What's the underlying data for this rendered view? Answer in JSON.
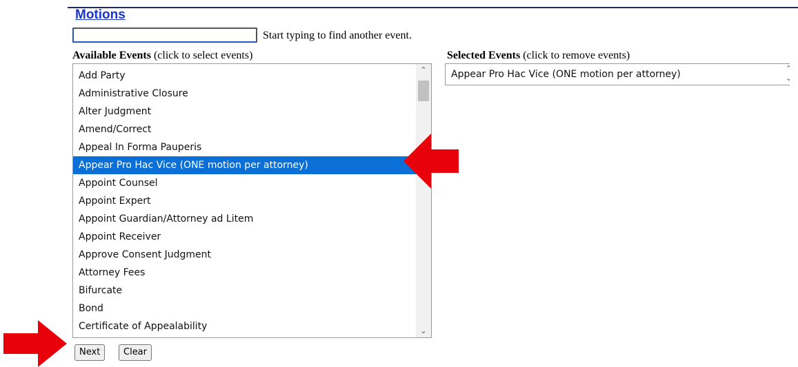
{
  "section": {
    "title": "Motions"
  },
  "search": {
    "value": "",
    "hint": "Start typing to find another event."
  },
  "available": {
    "label_bold": "Available Events",
    "label_rest": " (click to select events)",
    "items": [
      "Add Party",
      "Administrative Closure",
      "Alter Judgment",
      "Amend/Correct",
      "Appeal In Forma Pauperis",
      "Appear Pro Hac Vice (ONE motion per attorney)",
      "Appoint Counsel",
      "Appoint Expert",
      "Appoint Guardian/Attorney ad Litem",
      "Appoint Receiver",
      "Approve Consent Judgment",
      "Attorney Fees",
      "Bifurcate",
      "Bond",
      "Certificate of Appealability"
    ],
    "highlighted_item": "Appear Pro Hac Vice (ONE motion per attorney)"
  },
  "selected": {
    "label_bold": "Selected Events",
    "label_rest": " (click to remove events)",
    "items": [
      "Appear Pro Hac Vice (ONE motion per attorney)"
    ]
  },
  "buttons": {
    "next": "Next",
    "clear": "Clear"
  },
  "colors": {
    "title": "#1a35c9",
    "highlight": "#0a6fd6",
    "arrow": "#e8000b"
  },
  "icons": {
    "scroll_up": "chevron-up-icon",
    "scroll_down": "chevron-down-icon",
    "annotation": "red-arrow-icon"
  }
}
